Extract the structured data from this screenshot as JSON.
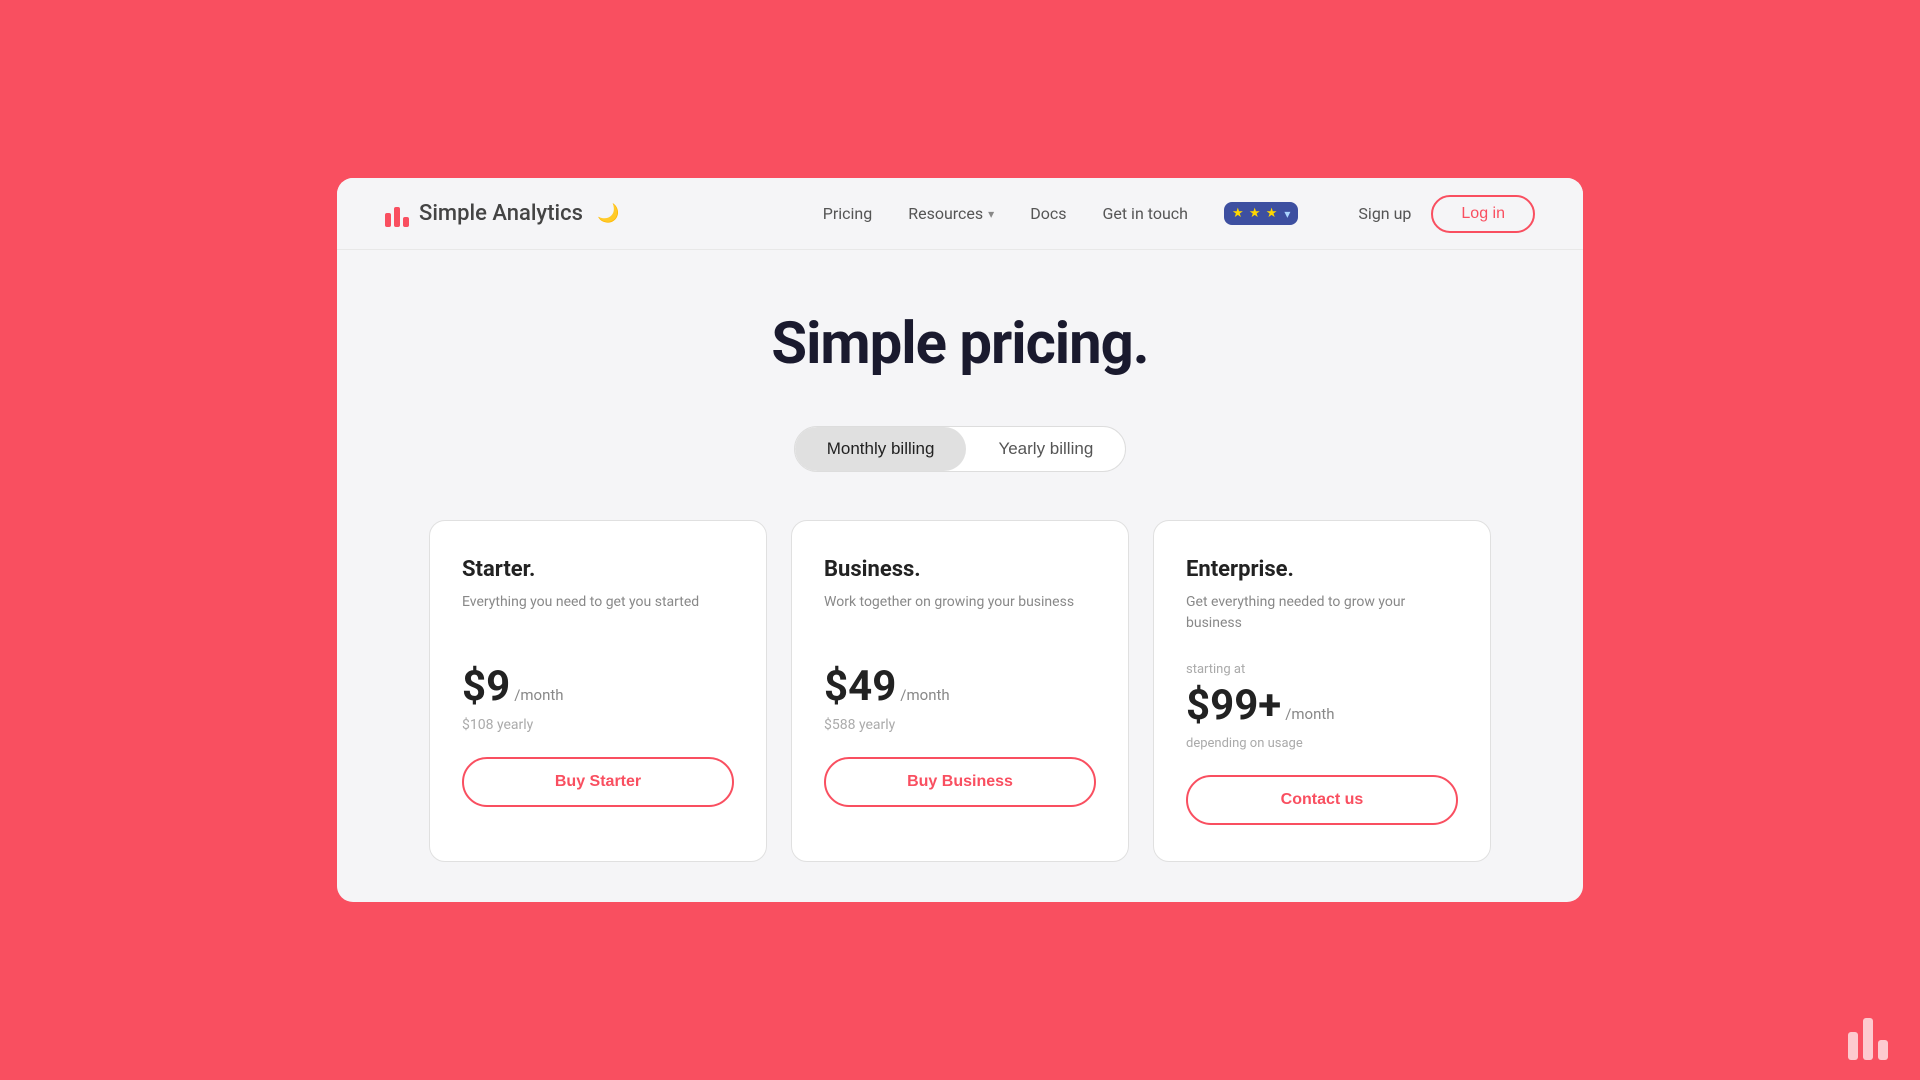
{
  "brand": {
    "name": "Simple Analytics",
    "logo_alt": "Simple Analytics logo"
  },
  "navbar": {
    "pricing_label": "Pricing",
    "resources_label": "Resources",
    "docs_label": "Docs",
    "get_in_touch_label": "Get in touch",
    "sign_up_label": "Sign up",
    "login_label": "Log in",
    "eu_stars": "✦ ✦ ✦"
  },
  "hero": {
    "title": "Simple pricing."
  },
  "billing_toggle": {
    "monthly_label": "Monthly billing",
    "yearly_label": "Yearly billing"
  },
  "plans": [
    {
      "name": "Starter.",
      "description": "Everything you need to get you started",
      "price": "$9",
      "period": "/month",
      "yearly": "$108 yearly",
      "cta": "Buy Starter",
      "starting_at": ""
    },
    {
      "name": "Business.",
      "description": "Work together on growing your business",
      "price": "$49",
      "period": "/month",
      "yearly": "$588 yearly",
      "cta": "Buy Business",
      "starting_at": ""
    },
    {
      "name": "Enterprise.",
      "description": "Get everything needed to grow your business",
      "price": "$99+",
      "period": "/month",
      "yearly": "",
      "cta": "Contact us",
      "starting_at": "starting at",
      "depending": "depending on usage"
    }
  ]
}
